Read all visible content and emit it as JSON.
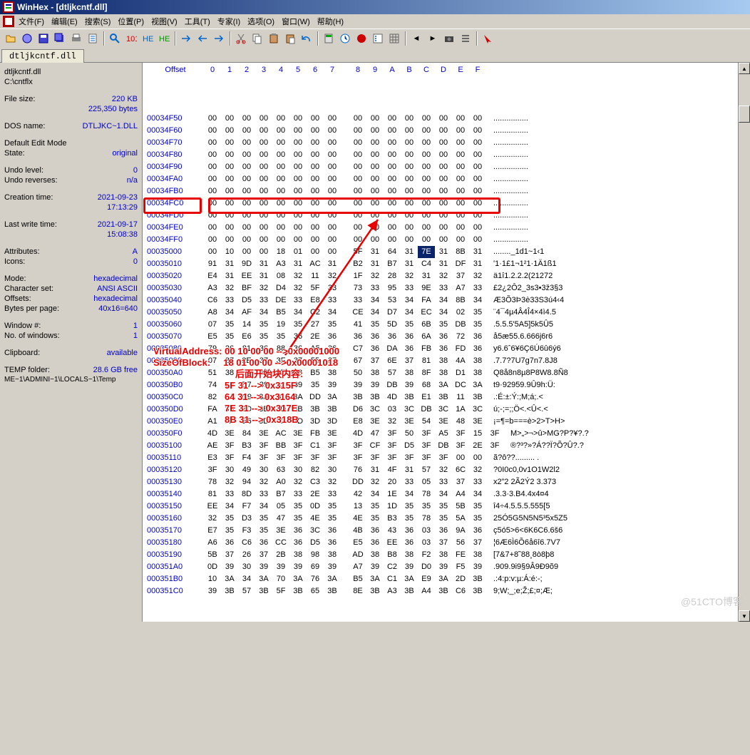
{
  "titlebar": {
    "title": "WinHex - [dtljkcntf.dll]"
  },
  "menus": [
    "文件(F)",
    "编辑(E)",
    "搜索(S)",
    "位置(P)",
    "视图(V)",
    "工具(T)",
    "专家(I)",
    "选项(O)",
    "窗口(W)",
    "帮助(H)"
  ],
  "tab": {
    "label": "dtljkcntf.dll"
  },
  "sidebar": {
    "fileName": "dtljkcntf.dll",
    "path": "C:\\cntflx",
    "fileSizeLabel": "File size:",
    "fileSize1": "220 KB",
    "fileSize2": "225,350 bytes",
    "dosNameLabel": "DOS name:",
    "dosName": "DTLJKC~1.DLL",
    "editModeHdr": "Default Edit Mode",
    "stateLabel": "State:",
    "state": "original",
    "undoLevelLabel": "Undo level:",
    "undoLevel": "0",
    "undoRevLabel": "Undo reverses:",
    "undoRev": "n/a",
    "creationLabel": "Creation time:",
    "creationDate": "2021-09-23",
    "creationTime": "17:13:29",
    "lastWriteLabel": "Last write time:",
    "lastWriteDate": "2021-09-17",
    "lastWriteTime": "15:08:38",
    "attrLabel": "Attributes:",
    "attr": "A",
    "iconsLabel": "Icons:",
    "icons": "0",
    "modeLabel": "Mode:",
    "mode": "hexadecimal",
    "charsetLabel": "Character set:",
    "charset": "ANSI ASCII",
    "offsetsLabel": "Offsets:",
    "offsets": "hexadecimal",
    "bppLabel": "Bytes per page:",
    "bpp": "40x16=640",
    "winNumLabel": "Window #:",
    "winNum": "1",
    "numWinLabel": "No. of windows:",
    "numWin": "1",
    "clipLabel": "Clipboard:",
    "clip": "available",
    "tempLabel": "TEMP folder:",
    "temp": "28.6 GB free",
    "tempPath": "ME~1\\ADMINI~1\\LOCALS~1\\Temp"
  },
  "hex": {
    "header": {
      "offset": "Offset",
      "cols": [
        "0",
        "1",
        "2",
        "3",
        "4",
        "5",
        "6",
        "7",
        "8",
        "9",
        "A",
        "B",
        "C",
        "D",
        "E",
        "F"
      ]
    },
    "rows": [
      {
        "off": "00034F50",
        "b": [
          "00",
          "00",
          "00",
          "00",
          "00",
          "00",
          "00",
          "00",
          "00",
          "00",
          "00",
          "00",
          "00",
          "00",
          "00",
          "00"
        ],
        "a": "................"
      },
      {
        "off": "00034F60",
        "b": [
          "00",
          "00",
          "00",
          "00",
          "00",
          "00",
          "00",
          "00",
          "00",
          "00",
          "00",
          "00",
          "00",
          "00",
          "00",
          "00"
        ],
        "a": "................"
      },
      {
        "off": "00034F70",
        "b": [
          "00",
          "00",
          "00",
          "00",
          "00",
          "00",
          "00",
          "00",
          "00",
          "00",
          "00",
          "00",
          "00",
          "00",
          "00",
          "00"
        ],
        "a": "................"
      },
      {
        "off": "00034F80",
        "b": [
          "00",
          "00",
          "00",
          "00",
          "00",
          "00",
          "00",
          "00",
          "00",
          "00",
          "00",
          "00",
          "00",
          "00",
          "00",
          "00"
        ],
        "a": "................"
      },
      {
        "off": "00034F90",
        "b": [
          "00",
          "00",
          "00",
          "00",
          "00",
          "00",
          "00",
          "00",
          "00",
          "00",
          "00",
          "00",
          "00",
          "00",
          "00",
          "00"
        ],
        "a": "................"
      },
      {
        "off": "00034FA0",
        "b": [
          "00",
          "00",
          "00",
          "00",
          "00",
          "00",
          "00",
          "00",
          "00",
          "00",
          "00",
          "00",
          "00",
          "00",
          "00",
          "00"
        ],
        "a": "................"
      },
      {
        "off": "00034FB0",
        "b": [
          "00",
          "00",
          "00",
          "00",
          "00",
          "00",
          "00",
          "00",
          "00",
          "00",
          "00",
          "00",
          "00",
          "00",
          "00",
          "00"
        ],
        "a": "................"
      },
      {
        "off": "00034FC0",
        "b": [
          "00",
          "00",
          "00",
          "00",
          "00",
          "00",
          "00",
          "00",
          "00",
          "00",
          "00",
          "00",
          "00",
          "00",
          "00",
          "00"
        ],
        "a": "................"
      },
      {
        "off": "00034FD0",
        "b": [
          "00",
          "00",
          "00",
          "00",
          "00",
          "00",
          "00",
          "00",
          "00",
          "00",
          "00",
          "00",
          "00",
          "00",
          "00",
          "00"
        ],
        "a": "................"
      },
      {
        "off": "00034FE0",
        "b": [
          "00",
          "00",
          "00",
          "00",
          "00",
          "00",
          "00",
          "00",
          "00",
          "00",
          "00",
          "00",
          "00",
          "00",
          "00",
          "00"
        ],
        "a": "................"
      },
      {
        "off": "00034FF0",
        "b": [
          "00",
          "00",
          "00",
          "00",
          "00",
          "00",
          "00",
          "00",
          "00",
          "00",
          "00",
          "00",
          "00",
          "00",
          "00",
          "00"
        ],
        "a": "................"
      },
      {
        "off": "00035000",
        "b": [
          "00",
          "10",
          "00",
          "00",
          "18",
          "01",
          "00",
          "00",
          "5F",
          "31",
          "64",
          "31",
          "7E",
          "31",
          "8B",
          "31"
        ],
        "a": "........_1d1~1‹1",
        "hi": true,
        "sel": 12
      },
      {
        "off": "00035010",
        "b": [
          "91",
          "31",
          "9D",
          "31",
          "A3",
          "31",
          "AC",
          "31",
          "B2",
          "31",
          "B7",
          "31",
          "C4",
          "31",
          "DF",
          "31"
        ],
        "a": "'1·1£1¬1²1·1Ä1ß1"
      },
      {
        "off": "00035020",
        "b": [
          "E4",
          "31",
          "EE",
          "31",
          "08",
          "32",
          "11",
          "32",
          "1F",
          "32",
          "28",
          "32",
          "31",
          "32",
          "37",
          "32"
        ],
        "a": "ä1î1.2.2.2(21272"
      },
      {
        "off": "00035030",
        "b": [
          "A3",
          "32",
          "BF",
          "32",
          "D4",
          "32",
          "5F",
          "33",
          "73",
          "33",
          "95",
          "33",
          "9E",
          "33",
          "A7",
          "33"
        ],
        "a": "£2¿2Ô2_3s3•3ž3§3"
      },
      {
        "off": "00035040",
        "b": [
          "C6",
          "33",
          "D5",
          "33",
          "DE",
          "33",
          "E8",
          "33",
          "33",
          "34",
          "53",
          "34",
          "FA",
          "34",
          "8B",
          "34"
        ],
        "a": "Æ3Õ3Þ3è33S3ú4‹4"
      },
      {
        "off": "00035050",
        "b": [
          "A8",
          "34",
          "AF",
          "34",
          "B5",
          "34",
          "C2",
          "34",
          "CE",
          "34",
          "D7",
          "34",
          "EC",
          "34",
          "02",
          "35"
        ],
        "a": "¨4¯4µ4Â4Î4×4ì4.5"
      },
      {
        "off": "00035060",
        "b": [
          "07",
          "35",
          "14",
          "35",
          "19",
          "35",
          "27",
          "35",
          "41",
          "35",
          "5D",
          "35",
          "6B",
          "35",
          "DB",
          "35"
        ],
        "a": ".5.5.5'5A5]5k5Û5"
      },
      {
        "off": "00035070",
        "b": [
          "E5",
          "35",
          "E6",
          "35",
          "35",
          "36",
          "2E",
          "36",
          "36",
          "36",
          "36",
          "36",
          "6A",
          "36",
          "72",
          "36"
        ],
        "a": "å5æ55.6.666j6r6"
      },
      {
        "off": "00035080",
        "b": [
          "79",
          "36",
          "81",
          "36",
          "88",
          "36",
          "A5",
          "36",
          "C7",
          "36",
          "DA",
          "36",
          "FB",
          "36",
          "FD",
          "36"
        ],
        "a": "y6.6ˆ6¥6Ç6Ú6û6ý6"
      },
      {
        "off": "00035090",
        "b": [
          "07",
          "37",
          "2E",
          "37",
          "3F",
          "37",
          "55",
          "37",
          "67",
          "37",
          "6E",
          "37",
          "81",
          "38",
          "4A",
          "38"
        ],
        "a": ".7.7?7U7g7n7.8J8"
      },
      {
        "off": "000350A0",
        "b": [
          "51",
          "38",
          "E5",
          "38",
          "6E",
          "38",
          "B5",
          "38",
          "50",
          "38",
          "57",
          "38",
          "8F",
          "38",
          "D1",
          "38"
        ],
        "a": "Q8å8n8µ8P8W8.8Ñ8"
      },
      {
        "off": "000350B0",
        "b": [
          "74",
          "39",
          "B7",
          "39",
          "32",
          "39",
          "35",
          "39",
          "39",
          "39",
          "DB",
          "39",
          "68",
          "3A",
          "DC",
          "3A"
        ],
        "a": "t9·92959.9Û9h:Ü:"
      },
      {
        "off": "000350C0",
        "b": [
          "82",
          "3A",
          "C9",
          "3A",
          "B1",
          "3A",
          "DD",
          "3A",
          "3B",
          "3B",
          "4D",
          "3B",
          "E1",
          "3B",
          "11",
          "3B"
        ],
        "a": ".:É:±:Ý:;M;á;.<"
      },
      {
        "off": "000350D0",
        "b": [
          "FA",
          "3B",
          "2D",
          "3B",
          "3D",
          "3B",
          "3B",
          "3B",
          "D6",
          "3C",
          "03",
          "3C",
          "DB",
          "3C",
          "1A",
          "3C"
        ],
        "a": "ú;-;=;;Ö<.<Û<.<"
      },
      {
        "off": "000350E0",
        "b": [
          "A1",
          "3D",
          "B6",
          "3D",
          "62",
          "3D",
          "3D",
          "3D",
          "E8",
          "3E",
          "32",
          "3E",
          "54",
          "3E",
          "48",
          "3E"
        ],
        "a": "¡=¶=b===è>2>T>H>"
      },
      {
        "off": "000350F0",
        "b": [
          "4D",
          "3E",
          "84",
          "3E",
          "AC",
          "3E",
          "FB",
          "3E",
          "4D",
          "47",
          "3F",
          "50",
          "3F",
          "A5",
          "3F",
          "15",
          "3F"
        ],
        "a": "M>„>¬>û>MG?P?¥?.?"
      },
      {
        "off": "00035100",
        "b": [
          "AE",
          "3F",
          "B3",
          "3F",
          "BB",
          "3F",
          "C1",
          "3F",
          "3F",
          "CF",
          "3F",
          "D5",
          "3F",
          "DB",
          "3F",
          "2E",
          "3F"
        ],
        "a": "®?³?»?Á??Ï?Õ?Û?.?"
      },
      {
        "off": "00035110",
        "b": [
          "E3",
          "3F",
          "F4",
          "3F",
          "3F",
          "3F",
          "3F",
          "3F",
          "3F",
          "3F",
          "3F",
          "3F",
          "3F",
          "3F",
          "00",
          "00"
        ],
        "a": "ã?ô??......... ."
      },
      {
        "off": "00035120",
        "b": [
          "3F",
          "30",
          "49",
          "30",
          "63",
          "30",
          "82",
          "30",
          "76",
          "31",
          "4F",
          "31",
          "57",
          "32",
          "6C",
          "32"
        ],
        "a": "?0I0c0‚0v1O1W2l2"
      },
      {
        "off": "00035130",
        "b": [
          "78",
          "32",
          "94",
          "32",
          "A0",
          "32",
          "C3",
          "32",
          "DD",
          "32",
          "20",
          "33",
          "05",
          "33",
          "37",
          "33"
        ],
        "a": "x2”2 2Ã2Ý2 3.373"
      },
      {
        "off": "00035140",
        "b": [
          "81",
          "33",
          "8D",
          "33",
          "B7",
          "33",
          "2E",
          "33",
          "42",
          "34",
          "1E",
          "34",
          "78",
          "34",
          "A4",
          "34"
        ],
        "a": ".3.3·3.B4.4x4¤4"
      },
      {
        "off": "00035150",
        "b": [
          "EE",
          "34",
          "F7",
          "34",
          "05",
          "35",
          "0D",
          "35",
          "13",
          "35",
          "1D",
          "35",
          "35",
          "35",
          "5B",
          "35"
        ],
        "a": "î4÷4.5.5.5.555[5"
      },
      {
        "off": "00035160",
        "b": [
          "32",
          "35",
          "D3",
          "35",
          "47",
          "35",
          "4E",
          "35",
          "4E",
          "35",
          "B3",
          "35",
          "78",
          "35",
          "5A",
          "35"
        ],
        "a": "25Ó5G5N5N5³5x5Z5"
      },
      {
        "off": "00035170",
        "b": [
          "E7",
          "35",
          "F3",
          "35",
          "3E",
          "36",
          "3C",
          "36",
          "4B",
          "36",
          "43",
          "36",
          "03",
          "36",
          "9A",
          "36"
        ],
        "a": "ç5ó5>6<6K6C6.6š6"
      },
      {
        "off": "00035180",
        "b": [
          "A6",
          "36",
          "C6",
          "36",
          "CC",
          "36",
          "D5",
          "36",
          "E5",
          "36",
          "EE",
          "36",
          "03",
          "37",
          "56",
          "37"
        ],
        "a": "¦6Æ6Ì6Õ6å6î6.7V7"
      },
      {
        "off": "00035190",
        "b": [
          "5B",
          "37",
          "26",
          "37",
          "2B",
          "38",
          "98",
          "38",
          "AD",
          "38",
          "B8",
          "38",
          "F2",
          "38",
          "FE",
          "38"
        ],
        "a": "[7&7+8˜8­8¸8ò8þ8"
      },
      {
        "off": "000351A0",
        "b": [
          "0D",
          "39",
          "30",
          "39",
          "39",
          "39",
          "69",
          "39",
          "A7",
          "39",
          "C2",
          "39",
          "D0",
          "39",
          "F5",
          "39"
        ],
        "a": ".909.9i9§9Â9Ð9õ9"
      },
      {
        "off": "000351B0",
        "b": [
          "10",
          "3A",
          "34",
          "3A",
          "70",
          "3A",
          "76",
          "3A",
          "B5",
          "3A",
          "C1",
          "3A",
          "E9",
          "3A",
          "2D",
          "3B"
        ],
        "a": ".:4:p:v:µ:Á:é:-;"
      },
      {
        "off": "000351C0",
        "b": [
          "39",
          "3B",
          "57",
          "3B",
          "5F",
          "3B",
          "65",
          "3B",
          "8E",
          "3B",
          "A3",
          "3B",
          "A4",
          "3B",
          "C6",
          "3B"
        ],
        "a": "9;W;_;e;Ž;£;¤;Æ;"
      }
    ]
  },
  "annotations": {
    "va": "VirtualAddress: 00 10 00 00 -->0x00001000",
    "sob": "SizeOfBlock:     18 01 00 00 -->0x00001018",
    "hdr": "后面开始块内容:",
    "l1": "5F 31 --> 0x315F",
    "l2": "64 31 --> 0x3164",
    "l3": "7E 31 --> 0x317E",
    "l4": "8B 31 --> 0x318B"
  },
  "watermark": "@51CTO博客"
}
